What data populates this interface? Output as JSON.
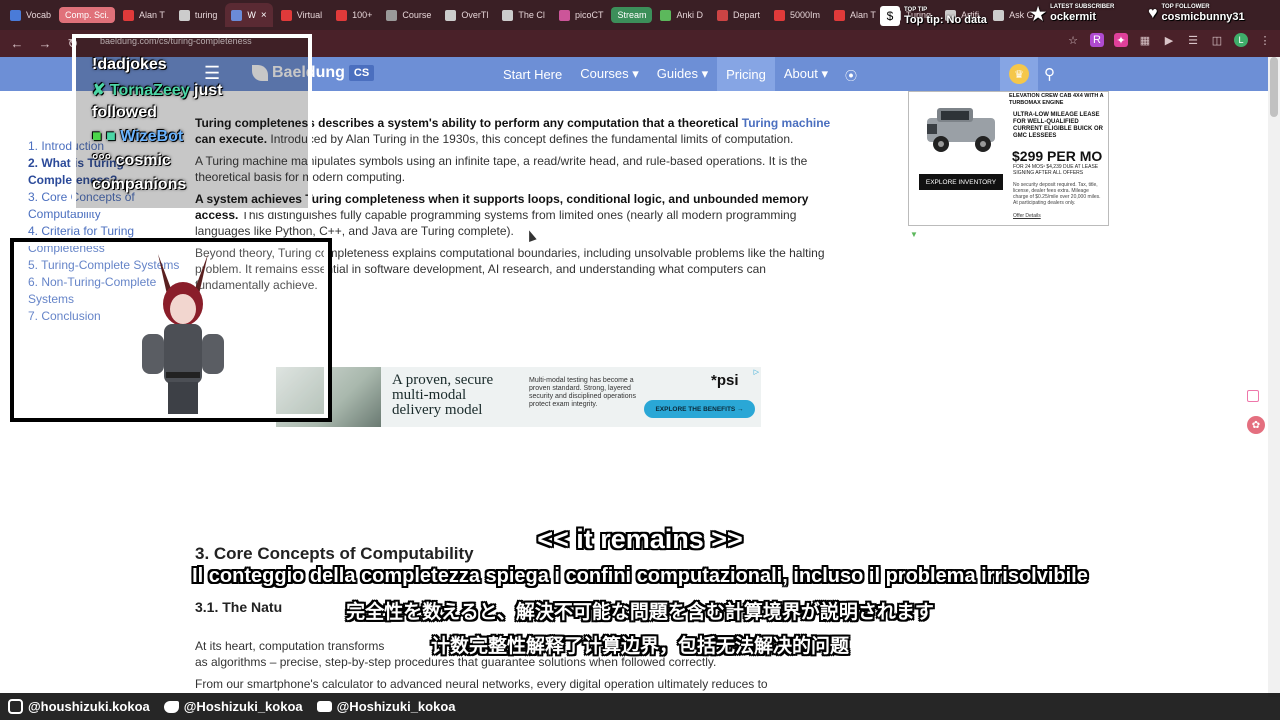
{
  "tabs": [
    {
      "label": "Vocab",
      "color": "#4a7bd8"
    },
    {
      "label": "Comp. Sci.",
      "color": "#e0717a",
      "style": "pill-red"
    },
    {
      "label": "Alan T",
      "color": "#e03a3a"
    },
    {
      "label": "turing",
      "color": "#cccccc"
    },
    {
      "label": "W",
      "color": "#6b8bd8",
      "active": true
    },
    {
      "label": "Virtual",
      "color": "#e03a3a"
    },
    {
      "label": "100+",
      "color": "#e03a3a"
    },
    {
      "label": "Course",
      "color": "#999999"
    },
    {
      "label": "OverTl",
      "color": "#cccccc"
    },
    {
      "label": "The Cl",
      "color": "#cccccc"
    },
    {
      "label": "picoCT",
      "color": "#cc5599"
    },
    {
      "label": "Stream",
      "color": "#3c8f5a",
      "style": "pill-green"
    },
    {
      "label": "Anki D",
      "color": "#5cb85c"
    },
    {
      "label": "Depart",
      "color": "#cc4444"
    },
    {
      "label": "5000Im",
      "color": "#e03a3a"
    },
    {
      "label": "Alan T",
      "color": "#e03a3a"
    },
    {
      "label": "Turing",
      "color": "#cccccc"
    },
    {
      "label": "Artifi",
      "color": "#cccccc"
    },
    {
      "label": "Ask G",
      "color": "#cccccc"
    }
  ],
  "browser": {
    "url": "baeldung.com/cs/turing-completeness",
    "avatar_letter": "L"
  },
  "site": {
    "logo_text": "Baeldung",
    "logo_badge": "CS",
    "menu": [
      {
        "label": "Start Here"
      },
      {
        "label": "Courses ▾"
      },
      {
        "label": "Guides ▾"
      },
      {
        "label": "Pricing",
        "active": true
      },
      {
        "label": "About ▾"
      }
    ]
  },
  "toc": {
    "items": [
      {
        "label": "1. Introduction"
      },
      {
        "label": "2. What is Turing Completeness?",
        "current": true
      },
      {
        "label": "3. Core Concepts of Computability"
      },
      {
        "label": "4. Criteria for Turing Completeness"
      },
      {
        "label": "5. Turing-Complete Systems"
      },
      {
        "label": "6. Non-Turing-Complete Systems"
      },
      {
        "label": "7. Conclusion"
      }
    ]
  },
  "article": {
    "p1_bold": "Turing completeness describes a system's ability to perform any computation that a theoretical ",
    "p1_link": "Turing machine",
    "p1_bold2": " can execute.",
    "p1_rest": " Introduced by Alan Turing in the 1930s, this concept defines the fundamental limits of computation.",
    "p2": "A Turing machine manipulates symbols using an infinite tape, a read/write head, and rule-based operations. It is the theoretical basis for modern computing.",
    "p3_bold": "A system achieves Turing completeness when it supports loops, conditional logic, and unbounded memory access.",
    "p3_rest": " This distinguishes fully capable programming systems from limited ones (nearly all modern programming languages like Python, C++, and Java are Turing complete).",
    "p4": "Beyond theory, Turing completeness explains computational boundaries, including unsolvable problems like the halting problem. It remains essential in software development, AI research, and understanding what computers can fundamentally achieve.",
    "h3": "3. Core Concepts of Computability",
    "h31": "3.1. The Natu",
    "p5": "At its heart, computation transforms",
    "p5_tail": "as algorithms – precise, step-by-step procedures that guarantee solutions when followed correctly.",
    "p6": "From our smartphone's calculator to advanced neural networks, every digital operation ultimately reduces to"
  },
  "ad_right": {
    "head": "ELEVATION CREW CAB 4X4 WITH A TURBOMAX ENGINE",
    "headline": "ULTRA-LOW MILEAGE LEASE FOR WELL-QUALIFIED CURRENT ELIGIBLE BUICK OR GMC LESSEES",
    "price": "$299 PER MO",
    "fine": "FOR 24 MOS¹ $4,239 DUE AT LEASE SIGNING AFTER ALL OFFERS",
    "disclaimer": "No security deposit required. Tax, title, license, dealer fees extra. Mileage charge of $0.25/mile over 20,000 miles. At participating dealers only.",
    "button": "EXPLORE INVENTORY",
    "offer": "Offer Details"
  },
  "ad_psi": {
    "headline": "A proven, secure multi-modal delivery model",
    "text": "Multi-modal testing has become a proven standard. Strong, layered security and disciplined operations protect exam integrity.",
    "logo": "*psi",
    "button": "EXPLORE THE BENEFITS →"
  },
  "chat": {
    "line1": "!dadjokes",
    "line2_name": "TornaZeey",
    "line2_rest": " just",
    "line3": "followed",
    "line4_name": "WizeBot",
    "line5": "cosmic",
    "line6": "companions"
  },
  "overlays": {
    "toptip_small": "TOP TIP",
    "toptip_big": "Top tip: No data",
    "latestsub_small": "LATEST SUBSCRIBER",
    "latestsub_big": "ockermit",
    "topfollower_small": "TOP FOLLOWER",
    "topfollower_big": "cosmicbunny31"
  },
  "subtitles": {
    "line1": "<< it remains >>",
    "line2": "Il conteggio della completezza spiega i confini computazionali, incluso il problema irrisolvibile",
    "line3": "完全性を数えると、解決不可能な問題を含む計算境界が説明されます",
    "line4": "计数完整性解释了计算边界，包括无法解决的问题"
  },
  "social": {
    "instagram": "@houshizuki.kokoa",
    "twitter": "@Hoshizuki_kokoa",
    "youtube": "@Hoshizuki_kokoa"
  },
  "colors": {
    "nav_blue": "#6d8fd6",
    "link_blue": "#4b6fbf",
    "chrome_dark": "#3a1f25"
  }
}
